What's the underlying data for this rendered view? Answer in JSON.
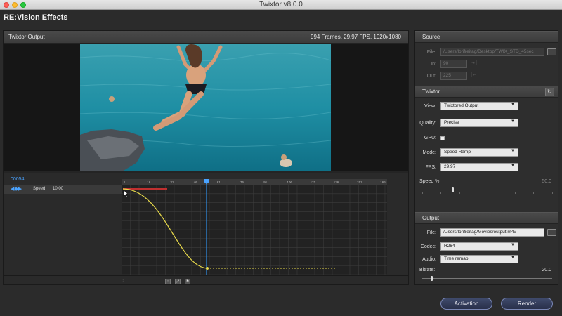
{
  "window": {
    "title": "Twixtor v8.0.0"
  },
  "brand": "RE:Vision Effects",
  "output_panel": {
    "title": "Twixtor Output",
    "info": "994 Frames, 29.97 FPS, 1920x1080"
  },
  "timeline": {
    "timecode": "00054",
    "track_name": "Speed",
    "track_value": "10.00",
    "ruler_labels": [
      "1",
      "16",
      "31",
      "46",
      "61",
      "76",
      "91",
      "106",
      "121",
      "136",
      "151",
      "166"
    ],
    "zero_label": "0"
  },
  "source": {
    "header": "Source",
    "file_label": "File:",
    "file_value": "/Users/lorifreitag/Desktop/TWIX_STD_45sec",
    "in_label": "In:",
    "in_value": "90",
    "out_label": "Out:",
    "out_value": "225"
  },
  "twixtor": {
    "header": "Twixtor",
    "view_label": "View:",
    "view_value": "Twixtored Output",
    "quality_label": "Quality:",
    "quality_value": "Precise",
    "gpu_label": "GPU:",
    "gpu_checked": true,
    "mode_label": "Mode:",
    "mode_value": "Speed Ramp",
    "fps_label": "FPS:",
    "fps_value": "29.97",
    "speed_label": "Speed %:",
    "speed_value": "50.0"
  },
  "output": {
    "header": "Output",
    "file_label": "File:",
    "file_value": "/Users/lorifreitag/Movies/output.m4v",
    "codec_label": "Codec:",
    "codec_value": "H264",
    "audio_label": "Audio:",
    "audio_value": "Time remap",
    "bitrate_label": "Bitrate:",
    "bitrate_value": "20.0"
  },
  "buttons": {
    "activation": "Activation",
    "render": "Render"
  },
  "colors": {
    "accent": "#4aa3ff",
    "curve": "#e6d84a",
    "button_border": "#7a87b5"
  }
}
